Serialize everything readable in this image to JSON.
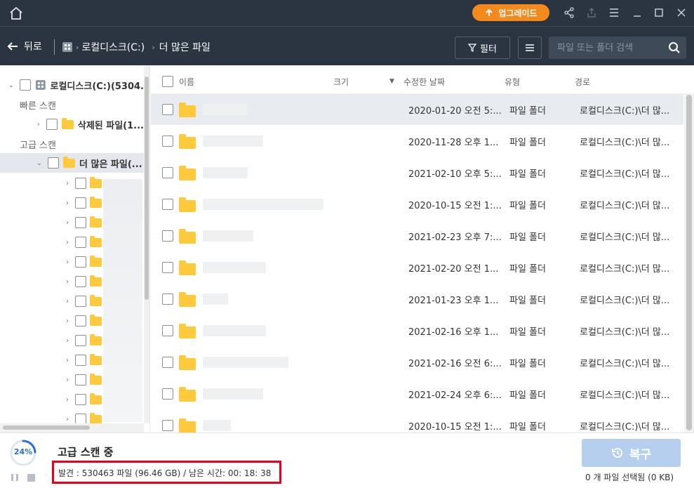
{
  "titlebar": {
    "upgrade_label": "업그레이드",
    "accent": "#f48a1c"
  },
  "nav": {
    "back_label": "뒤로",
    "breadcrumb": [
      "로컬디스크(C:)",
      "더 많은 파일"
    ],
    "filter_label": "필터",
    "search_placeholder": "파일 또는 폴더 검색"
  },
  "tree": {
    "root_label": "로컬디스크(C:)(5304.",
    "quick_scan_label": "빠른 스캔",
    "deleted_label": "삭제된 파일(1...",
    "advanced_scan_label": "고급 스캔",
    "more_files_label": "더 많은 파일(..."
  },
  "list": {
    "headers": {
      "name": "이름",
      "size": "크기",
      "modified": "수정한 날짜",
      "type": "유형",
      "path": "경로"
    },
    "rows": [
      {
        "date": "2020-01-20 오전 5:...",
        "type": "파일 폴더",
        "path": "로컬디스크(C:)\\더 많..."
      },
      {
        "date": "2020-11-28 오후 1...",
        "type": "파일 폴더",
        "path": "로컬디스크(C:)\\더 많..."
      },
      {
        "date": "2021-02-10 오후 5:...",
        "type": "파일 폴더",
        "path": "로컬디스크(C:)\\더 많..."
      },
      {
        "date": "2020-10-15 오전 1:...",
        "type": "파일 폴더",
        "path": "로컬디스크(C:)\\더 많..."
      },
      {
        "date": "2021-02-23 오후 7:...",
        "type": "파일 폴더",
        "path": "로컬디스크(C:)\\더 많..."
      },
      {
        "date": "2021-02-20 오전 1...",
        "type": "파일 폴더",
        "path": "로컬디스크(C:)\\더 많..."
      },
      {
        "date": "2021-01-23 오후 1...",
        "type": "파일 폴더",
        "path": "로컬디스크(C:)\\더 많..."
      },
      {
        "date": "2021-02-16 오후 1...",
        "type": "파일 폴더",
        "path": "로컬디스크(C:)\\더 많..."
      },
      {
        "date": "2021-02-16 오전 6:...",
        "type": "파일 폴더",
        "path": "로컬디스크(C:)\\더 많..."
      },
      {
        "date": "2021-02-24 오후 6:...",
        "type": "파일 폴더",
        "path": "로컬디스크(C:)\\더 많..."
      },
      {
        "date": "2020-10-15 오전 1:...",
        "type": "파일 폴더",
        "path": "로컬디스크(C:)\\더 많..."
      }
    ]
  },
  "bottom": {
    "progress_text": "24%",
    "progress_value": 24,
    "scan_title": "고급 스캔 중",
    "scan_status": "발견 : 530463 파일 (96.46 GB) / 남은 시간: 00: 18: 38",
    "recover_label": "복구",
    "selection_info": "0 개 파일 선택됨 (0 KB)"
  }
}
